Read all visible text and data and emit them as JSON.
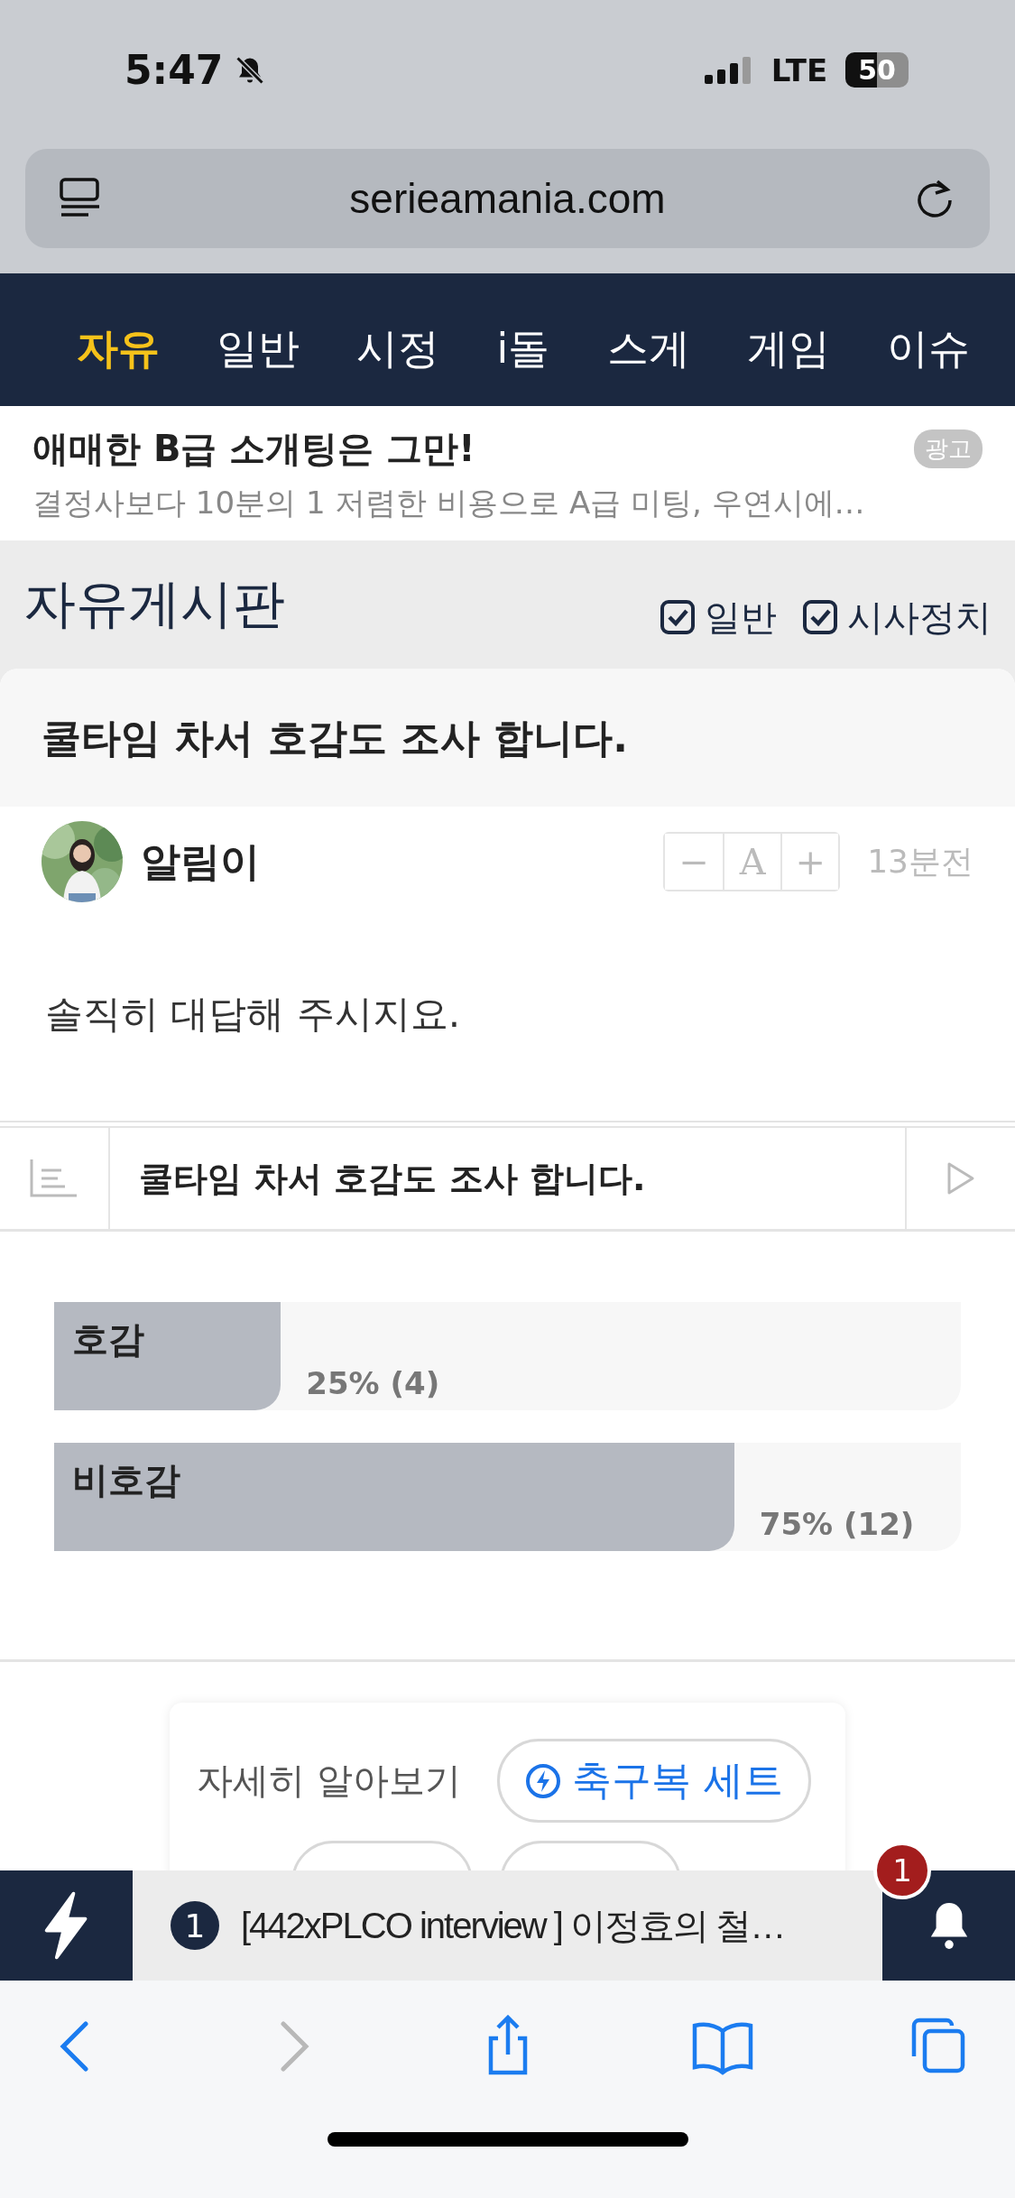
{
  "status_bar": {
    "time": "5:47",
    "network": "LTE",
    "battery": "50"
  },
  "browser": {
    "url": "serieamania.com"
  },
  "nav_tabs": [
    {
      "label": "자유",
      "selected": true
    },
    {
      "label": "일반",
      "selected": false
    },
    {
      "label": "시정",
      "selected": false
    },
    {
      "label": "i돌",
      "selected": false
    },
    {
      "label": "스게",
      "selected": false
    },
    {
      "label": "게임",
      "selected": false
    },
    {
      "label": "이슈",
      "selected": false
    }
  ],
  "ad": {
    "title": "애매한 B급 소개팅은 그만!",
    "text": "결정사보다 10분의 1 저렴한 비용으로 A급 미팅, 우연시에…",
    "badge": "광고"
  },
  "board": {
    "title": "자유게시판",
    "filters": [
      {
        "label": "일반",
        "checked": true
      },
      {
        "label": "시사정치",
        "checked": true
      }
    ]
  },
  "post": {
    "title": "쿨타임 차서 호감도 조사 합니다.",
    "author": "알림이",
    "time": "13분전",
    "font_controls": [
      "−",
      "A",
      "+"
    ],
    "body": "솔직히 대답해 주시지요.",
    "nav_title": "쿨타임 차서 호감도 조사 합니다."
  },
  "poll": [
    {
      "label": "호감",
      "level": 0.25,
      "reading": "25% (4)"
    },
    {
      "label": "비호감",
      "level": 0.75,
      "reading": "75% (12)"
    }
  ],
  "recommend": {
    "label": "자세히 알아보기",
    "chips": [
      {
        "label": "축구복 세트"
      },
      {
        "kind": "hidden"
      },
      {
        "kind": "hidden"
      }
    ]
  },
  "notice_bar": {
    "count": "1",
    "text": "[442xPLCO interview ] 이정효의 철…",
    "badge": "1"
  },
  "toolbar": [
    {
      "kind": "back",
      "disabled": false
    },
    {
      "kind": "forward",
      "disabled": true
    },
    {
      "kind": "share",
      "disabled": false
    },
    {
      "kind": "bookmarks",
      "disabled": false
    },
    {
      "kind": "tabs",
      "disabled": false
    }
  ]
}
